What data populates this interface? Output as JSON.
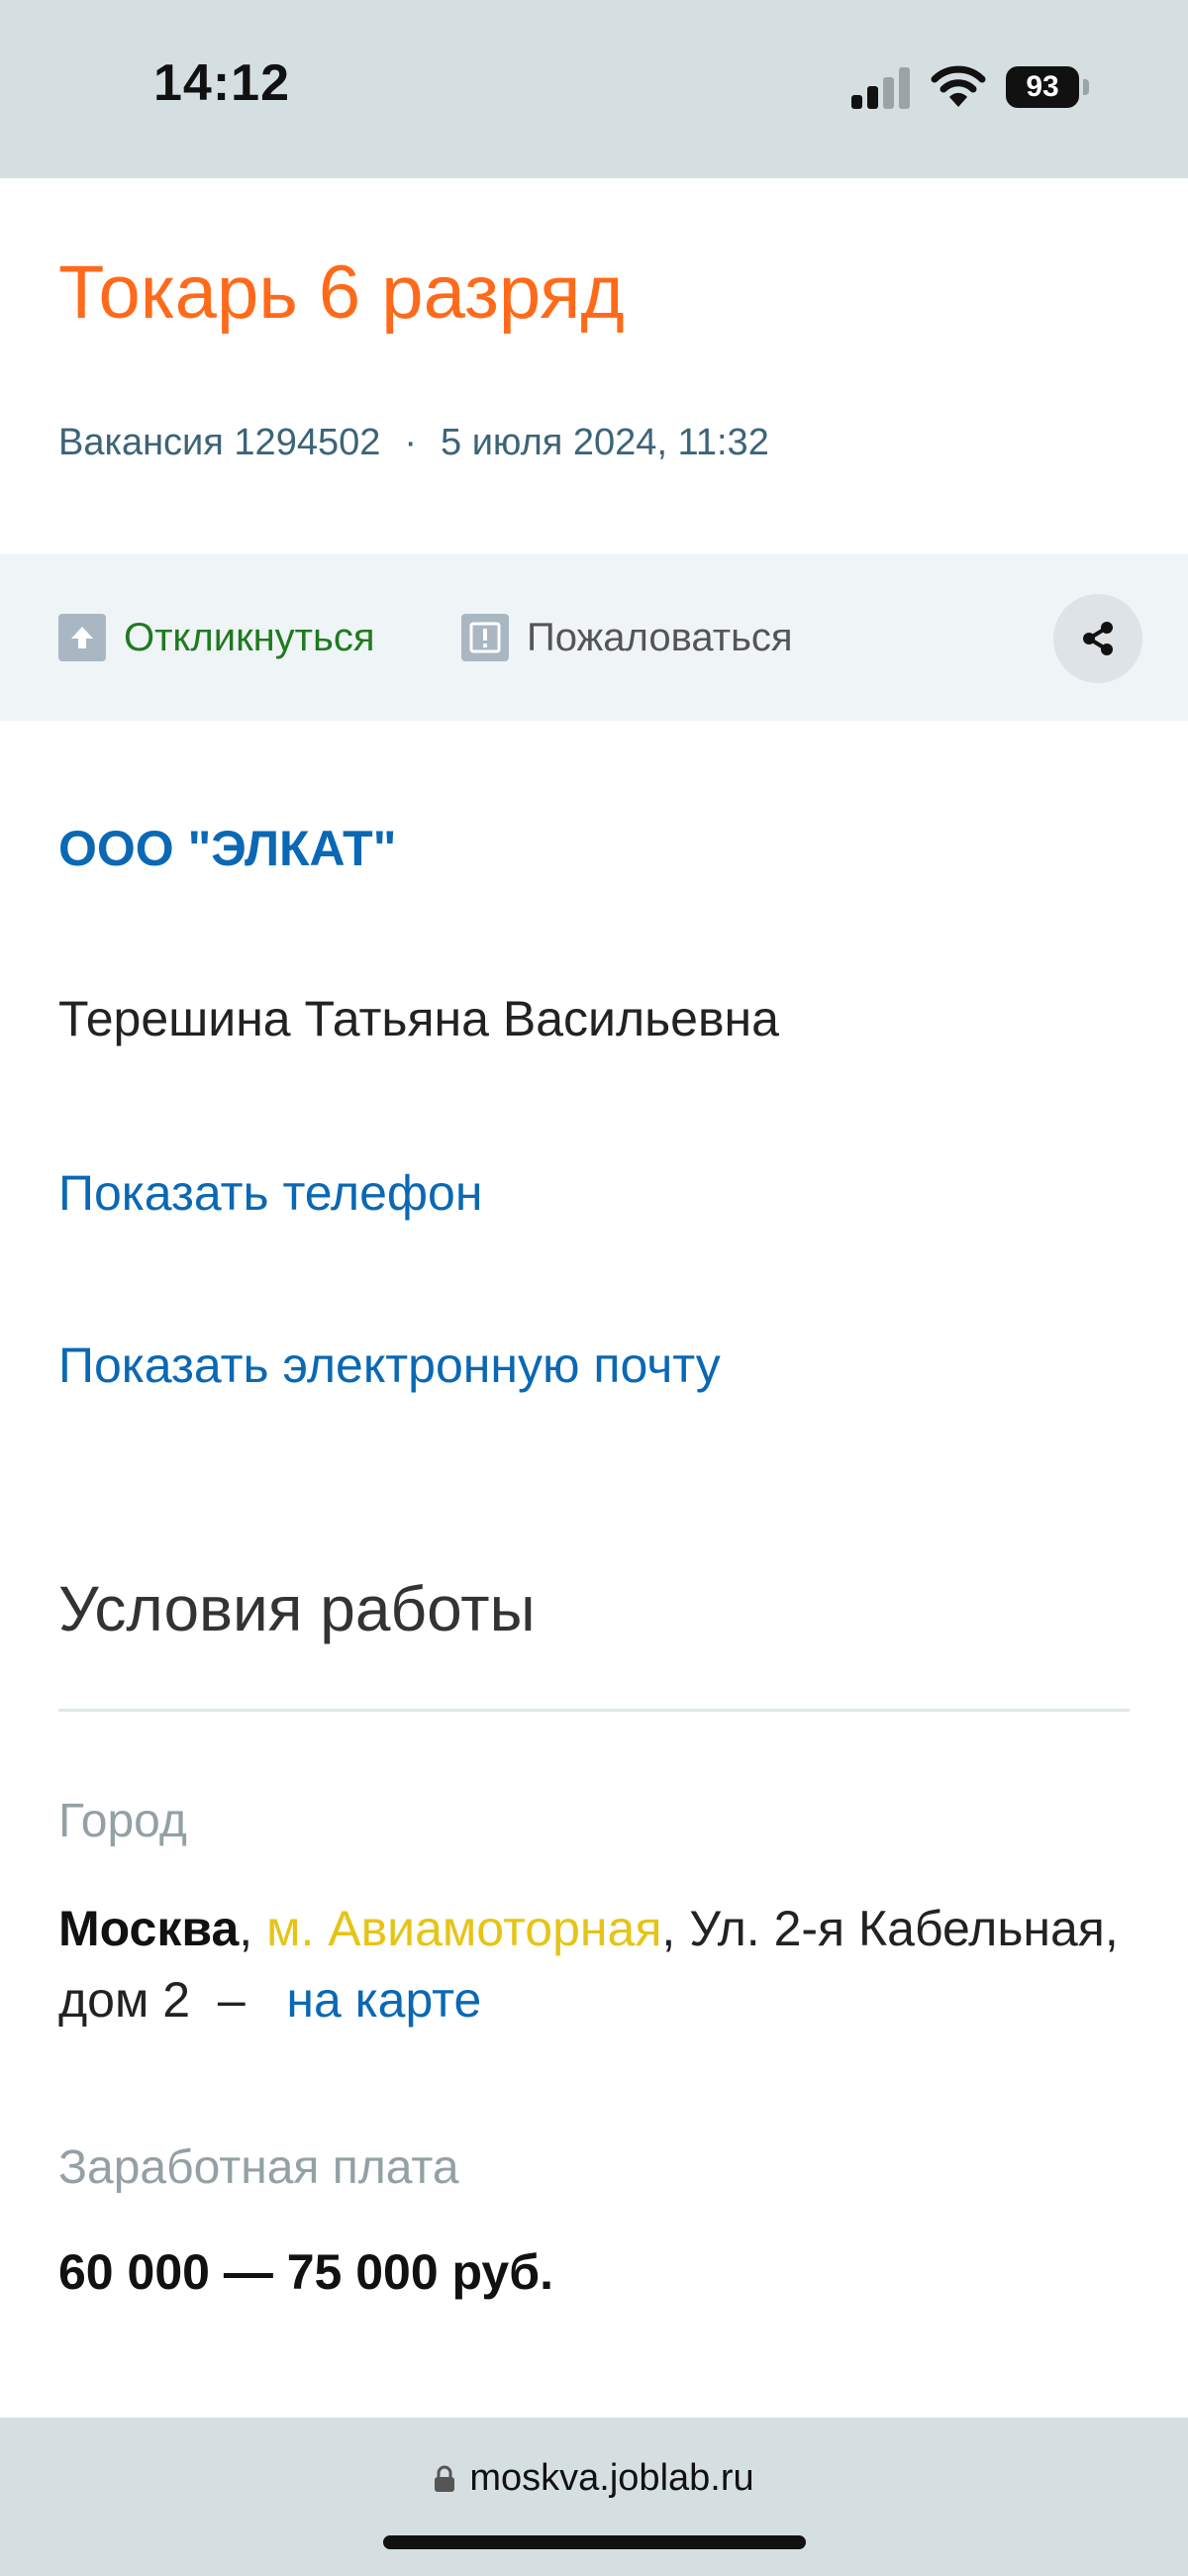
{
  "status_bar": {
    "time": "14:12",
    "battery": "93",
    "icons": [
      "signal-icon",
      "wifi-icon",
      "battery-icon"
    ]
  },
  "vacancy": {
    "title": "Токарь 6 разряд",
    "number": "Вакансия 1294502",
    "separator": "·",
    "date": "5 июля 2024, 11:32"
  },
  "actions": {
    "respond_label": "Откликнуться",
    "complain_label": "Пожаловаться",
    "share_icon": "share-icon"
  },
  "employer": {
    "company": "ООО \"ЭЛКАТ\"",
    "contact_name": "Терешина Татьяна Васильевна",
    "show_phone": "Показать телефон",
    "show_email": "Показать электронную почту"
  },
  "conditions": {
    "section_title": "Условия работы",
    "city_label": "Город",
    "city": "Москва",
    "comma1": ",",
    "metro": "м. Авиамоторная",
    "street": ", Ул. 2-я Кабельная, дом 2",
    "dash": "–",
    "map_link": "на карте",
    "salary_label": "Заработная плата",
    "salary": "60 000 — 75 000 руб."
  },
  "browser": {
    "url": "moskva.joblab.ru"
  },
  "colors": {
    "title": "#ff6a1a",
    "link": "#0a68b4",
    "respond": "#1f7a1f",
    "metro": "#e6c417"
  }
}
